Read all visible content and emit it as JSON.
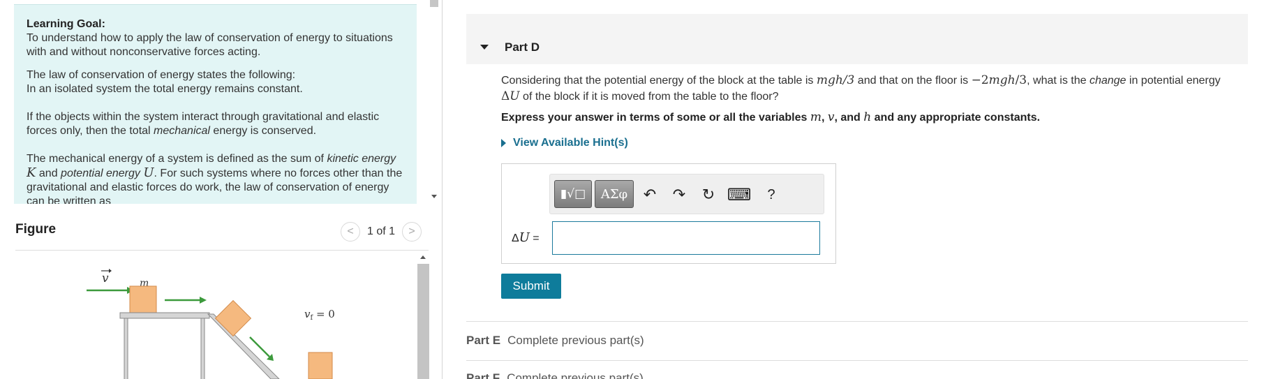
{
  "learning_goal": {
    "title": "Learning Goal:",
    "p1": "To understand how to apply the law of conservation of energy to situations with and without nonconservative forces acting.",
    "p2a": "The law of conservation of energy states the following:",
    "p2b": "In an isolated system the total energy remains constant.",
    "p3a": "If the objects within the system interact through gravitational and elastic forces only, then the total ",
    "p3i": "mechanical",
    "p3b": " energy is conserved.",
    "p4a": "The mechanical energy of a system is defined as the sum of ",
    "p4i1": "kinetic energy",
    "p4v1": "K",
    "p4b": " and ",
    "p4i2": "potential energy",
    "p4v2": "U",
    "p4c": ". For such systems where no forces other than the gravitational and elastic forces do work, the law of conservation of energy can be written as"
  },
  "figure": {
    "title": "Figure",
    "pager_text": "1 of 1",
    "prev_glyph": "<",
    "next_glyph": ">",
    "label_v": "v",
    "label_m": "m",
    "label_vf": "v",
    "label_vf_sub": "f",
    "label_vf_val": " = 0"
  },
  "part_d": {
    "title": "Part D",
    "q_a": "Considering that the potential energy of the block at the table is ",
    "q_m1": "mgh",
    "q_m1b": "/3",
    "q_b": " and that on the floor is ",
    "q_m2": "−2",
    "q_m2b": "mgh",
    "q_m2c": "/3",
    "q_c": ", what is the ",
    "q_i": "change",
    "q_d": " in potential energy ",
    "q_du": "Δ",
    "q_du2": "U",
    "q_e": " of the block if it is moved from the table to the floor?",
    "instr_a": "Express your answer in terms of some or all the variables ",
    "instr_m": "m",
    "instr_v": "v",
    "instr_h": "h",
    "instr_sep1": ", ",
    "instr_sep2": ", and ",
    "instr_b": " and any appropriate constants.",
    "hint_label": "View Available Hint(s)",
    "answer_label_d": "Δ",
    "answer_label_u": "U",
    "answer_label_eq": " =",
    "answer_value": "",
    "toolbar": {
      "templates_glyph": "▮√□",
      "symbols_glyph": "ΑΣφ",
      "undo_glyph": "↶",
      "redo_glyph": "↷",
      "reset_glyph": "↻",
      "keyboard_glyph": "⌨",
      "help_glyph": "?"
    },
    "submit_label": "Submit"
  },
  "part_e": {
    "label": "Part E",
    "status": "Complete previous part(s)"
  },
  "part_f": {
    "label": "Part F",
    "status": "Complete previous part(s)"
  },
  "colors": {
    "goal_bg": "#e2f5f5",
    "accent": "#0e7c9b",
    "hint": "#1a6f8f",
    "block": "#f5b97f"
  }
}
